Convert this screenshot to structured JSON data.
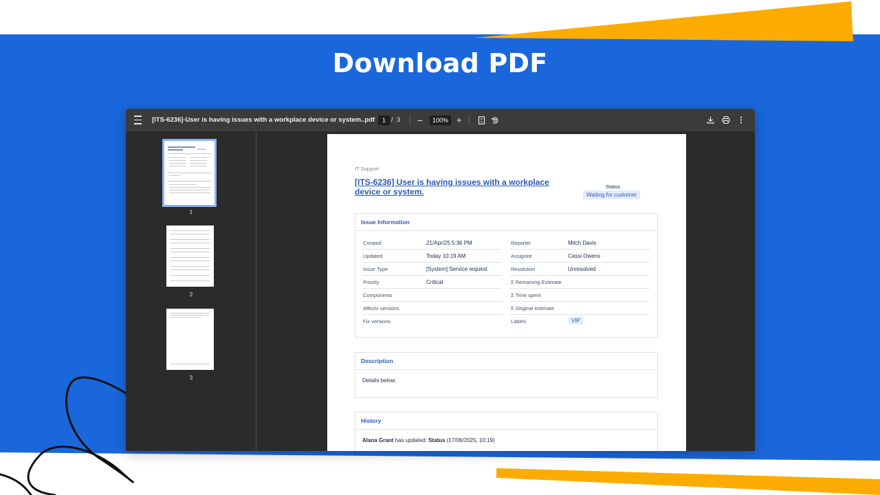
{
  "banner": {
    "title": "Download PDF"
  },
  "colors": {
    "banner_blue": "#1a67dc",
    "accent_orange": "#fcac00",
    "link_blue": "#2a5bb8"
  },
  "toolbar": {
    "menu_icon": "hamburger-icon",
    "title": "[ITS-6236]-User is having issues with a workplace device or system..pdf",
    "current_page": "1",
    "page_separator": "/",
    "total_pages": "3",
    "zoom_minus": "−",
    "zoom": "100%",
    "zoom_plus": "+",
    "icons": [
      "fit-page-icon",
      "rotate-icon",
      "download-icon",
      "print-icon",
      "more-vert-icon"
    ]
  },
  "sidebar": {
    "thumbnails": [
      {
        "label": "1"
      },
      {
        "label": "2"
      },
      {
        "label": "3"
      }
    ]
  },
  "document": {
    "project": "IT Support",
    "title": "[ITS-6236]  User is having issues with a workplace device or system.",
    "status_label": "Status",
    "status_value": "Waiting for customer",
    "issue_info": {
      "heading": "Issue Information",
      "left": [
        {
          "label": "Created",
          "value": "21/Apr/25 5:36 PM"
        },
        {
          "label": "Updated",
          "value": "Today 10:19 AM"
        },
        {
          "label": "Issue Type",
          "value": "[System] Service request"
        },
        {
          "label": "Priority",
          "value": "Critical"
        },
        {
          "label": "Components",
          "value": ""
        },
        {
          "label": "Affects versions",
          "value": ""
        },
        {
          "label": "Fix versions",
          "value": ""
        }
      ],
      "right": [
        {
          "label": "Reporter",
          "value": "Mitch Davis"
        },
        {
          "label": "Assignee",
          "value": "Cassi Owens"
        },
        {
          "label": "Resolution",
          "value": "Unresolved"
        },
        {
          "label": "Σ Remaining Estimate",
          "value": ""
        },
        {
          "label": "Σ Time spent",
          "value": ""
        },
        {
          "label": "Σ Original estimate",
          "value": ""
        },
        {
          "label": "Labels",
          "value": "VIP"
        }
      ]
    },
    "description": {
      "heading": "Description",
      "text": "Details below."
    },
    "history": {
      "heading": "History",
      "user": "Alana Grant",
      "action": " has updated:  ",
      "field": "Status",
      "when": "  (17/06/2025, 10:19)"
    }
  }
}
